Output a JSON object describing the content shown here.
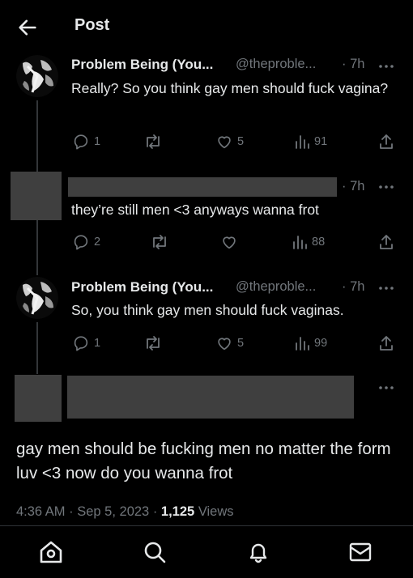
{
  "header": {
    "title": "Post"
  },
  "tweets": [
    {
      "name": "Problem Being (You...",
      "handle": "@theproble...",
      "time": "· 7h",
      "text": "Really? So you think gay men should fuck vagina?",
      "replies": "1",
      "reposts": "",
      "likes": "5",
      "views": "91"
    },
    {
      "time": "· 7h",
      "text": "they’re still men <3 anyways wanna frot",
      "replies": "2",
      "reposts": "",
      "likes": "",
      "views": "88"
    },
    {
      "name": "Problem Being (You...",
      "handle": "@theproble...",
      "time": "· 7h",
      "text": "So, you think gay men should fuck vaginas.",
      "replies": "1",
      "reposts": "",
      "likes": "5",
      "views": "99"
    }
  ],
  "main_post": {
    "text": "gay men should be fucking men no matter the form luv <3 now do you wanna frot",
    "time": "4:36 AM",
    "date": "Sep 5, 2023",
    "views_count": "1,125",
    "views_label": "Views"
  },
  "icons": {
    "back": "arrow-left-icon",
    "more": "more-dots-icon",
    "reply": "reply-icon",
    "repost": "repost-icon",
    "like": "heart-icon",
    "views": "views-bar-icon",
    "share": "share-icon",
    "nav_home": "home-icon",
    "nav_search": "search-icon",
    "nav_notifications": "bell-icon",
    "nav_messages": "envelope-icon"
  },
  "colors": {
    "background": "#000000",
    "text": "#e7e9ea",
    "secondary": "#71767b",
    "redaction": "#3f3f3f"
  }
}
